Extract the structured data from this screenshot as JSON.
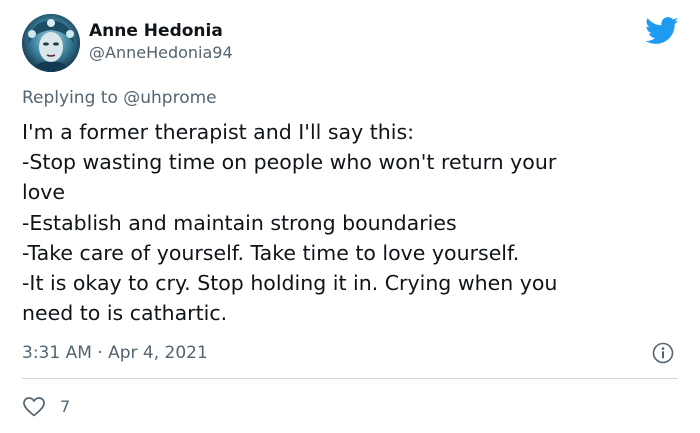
{
  "author": {
    "display_name": "Anne Hedonia",
    "handle": "@AnneHedonia94"
  },
  "reply": {
    "prefix": "Replying to",
    "to_handle": "@uhprome"
  },
  "tweet": {
    "lines": [
      "I'm a former therapist and I'll say this:",
      "-Stop wasting time on people who won't return your",
      "love",
      "-Establish and maintain strong boundaries",
      "-Take care of yourself. Take time to love yourself.",
      "-It is okay to cry. Stop holding it in. Crying when you",
      "need to is cathartic."
    ],
    "timestamp": "3:31 AM · Apr 4, 2021"
  },
  "actions": {
    "like_count": "7"
  },
  "icons": {
    "brand": "twitter-bird-icon",
    "info": "info-icon",
    "like": "heart-icon"
  },
  "colors": {
    "brand_blue": "#1d9bf0",
    "text_primary": "#0f1419",
    "text_secondary": "#536471",
    "divider": "#cfd9de"
  }
}
